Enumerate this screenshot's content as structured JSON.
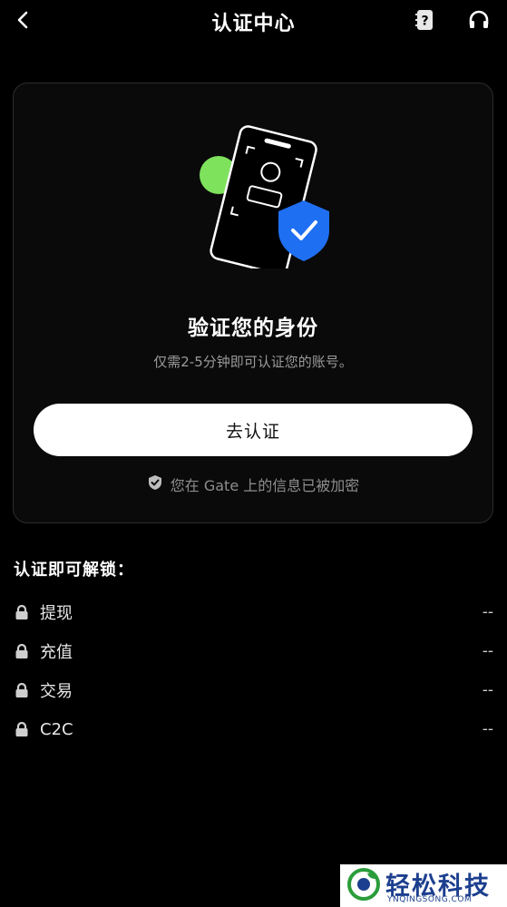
{
  "header": {
    "title": "认证中心",
    "back_icon": "chevron-left-icon",
    "help_icon": "help-book-icon",
    "support_icon": "headset-icon"
  },
  "card": {
    "title": "验证您的身份",
    "subtitle": "仅需2-5分钟即可认证您的账号。",
    "button_label": "去认证",
    "secure_note": "您在 Gate 上的信息已被加密",
    "illustration_icon": "id-card-shield-illustration",
    "accent_color": "#7ee25c",
    "shield_color": "#1f6ff2"
  },
  "unlock": {
    "title": "认证即可解锁：",
    "items": [
      {
        "label": "提现",
        "value": "--"
      },
      {
        "label": "充值",
        "value": "--"
      },
      {
        "label": "交易",
        "value": "--"
      },
      {
        "label": "C2C",
        "value": "--"
      }
    ]
  },
  "watermark": {
    "text": "轻松科技",
    "sub": "YNQINGSONG.COM"
  }
}
